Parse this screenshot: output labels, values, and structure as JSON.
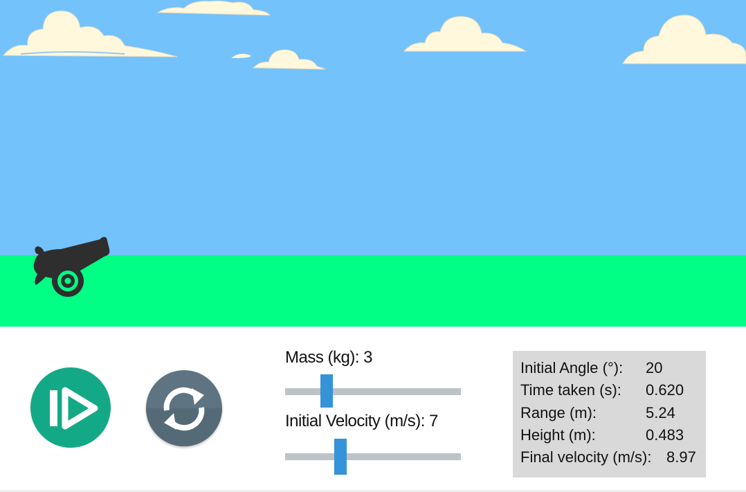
{
  "colors": {
    "sky": "#73c2fb",
    "ground": "#00ff84",
    "play_button": "#13a986",
    "reset_button": "#5e7482",
    "slider_thumb": "#3593d9",
    "slider_track": "#bcc3c8",
    "stats_panel": "#d9d9d9",
    "cannon": "#2e2e2e"
  },
  "icons": {
    "play": "play-icon",
    "reset": "refresh-icon",
    "cannon": "cannon-icon",
    "cloud": "cloud-icon"
  },
  "controls": {
    "mass": {
      "label": "Mass (kg): 3",
      "value": 3,
      "slider_fraction": 0.2
    },
    "velocity": {
      "label": "Initial Velocity (m/s): 7",
      "value": 7,
      "slider_fraction": 0.28
    }
  },
  "stats": [
    {
      "label": "Initial Angle (°):",
      "value": "20"
    },
    {
      "label": "Time taken (s):",
      "value": "0.620"
    },
    {
      "label": "Range (m):",
      "value": "5.24"
    },
    {
      "label": "Height (m):",
      "value": "0.483"
    },
    {
      "label": "Final velocity (m/s):",
      "value": "8.97"
    }
  ]
}
